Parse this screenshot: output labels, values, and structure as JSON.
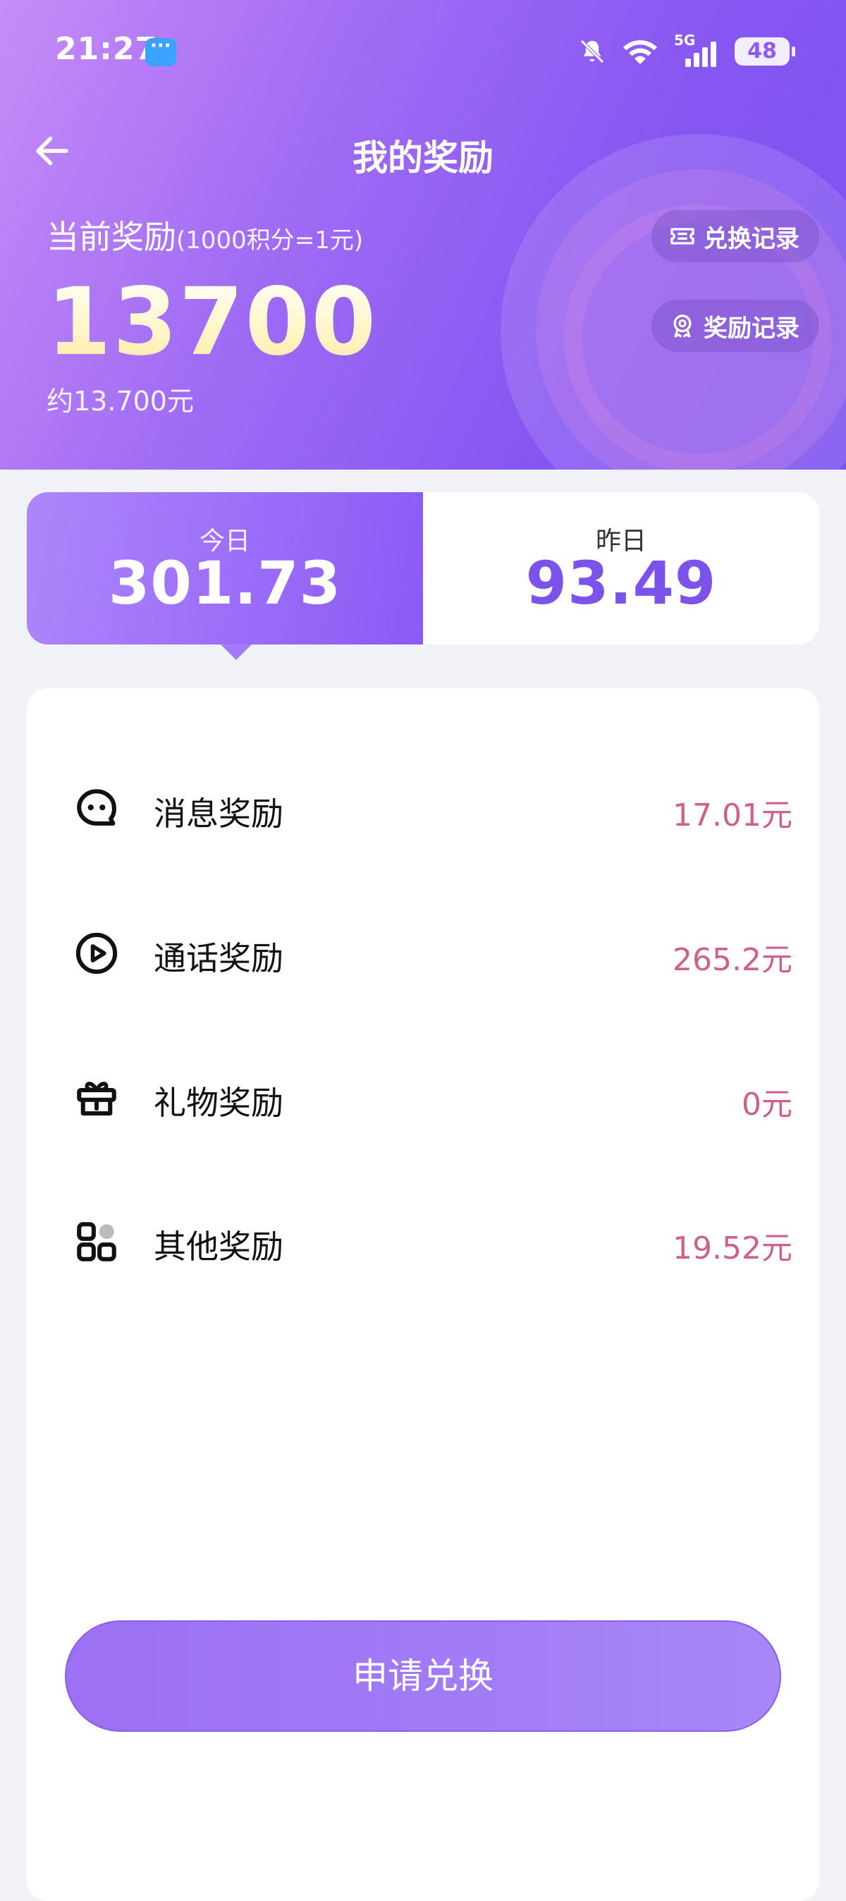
{
  "status_bar": {
    "time": "21:27",
    "network_tag": "5G",
    "battery": "48"
  },
  "nav": {
    "title": "我的奖励"
  },
  "summary": {
    "label": "当前奖励",
    "note": "(1000积分=1元)",
    "value": "13700",
    "approx": "约13.700元",
    "exchange_record_label": "兑换记录",
    "reward_record_label": "奖励记录"
  },
  "tabs": {
    "today_label": "今日",
    "today_value": "301.73",
    "yesterday_label": "昨日",
    "yesterday_value": "93.49"
  },
  "rewards": {
    "items": [
      {
        "label": "消息奖励",
        "value": "17.01元",
        "icon": "message-icon"
      },
      {
        "label": "通话奖励",
        "value": "265.2元",
        "icon": "call-play-icon"
      },
      {
        "label": "礼物奖励",
        "value": "0元",
        "icon": "gift-icon"
      },
      {
        "label": "其他奖励",
        "value": "19.52元",
        "icon": "apps-icon"
      }
    ]
  },
  "actions": {
    "apply_label": "申请兑换"
  },
  "colors": {
    "brand": "#8656f2",
    "value_text": "#d0608a",
    "yesterday_value": "#7b52ea"
  }
}
